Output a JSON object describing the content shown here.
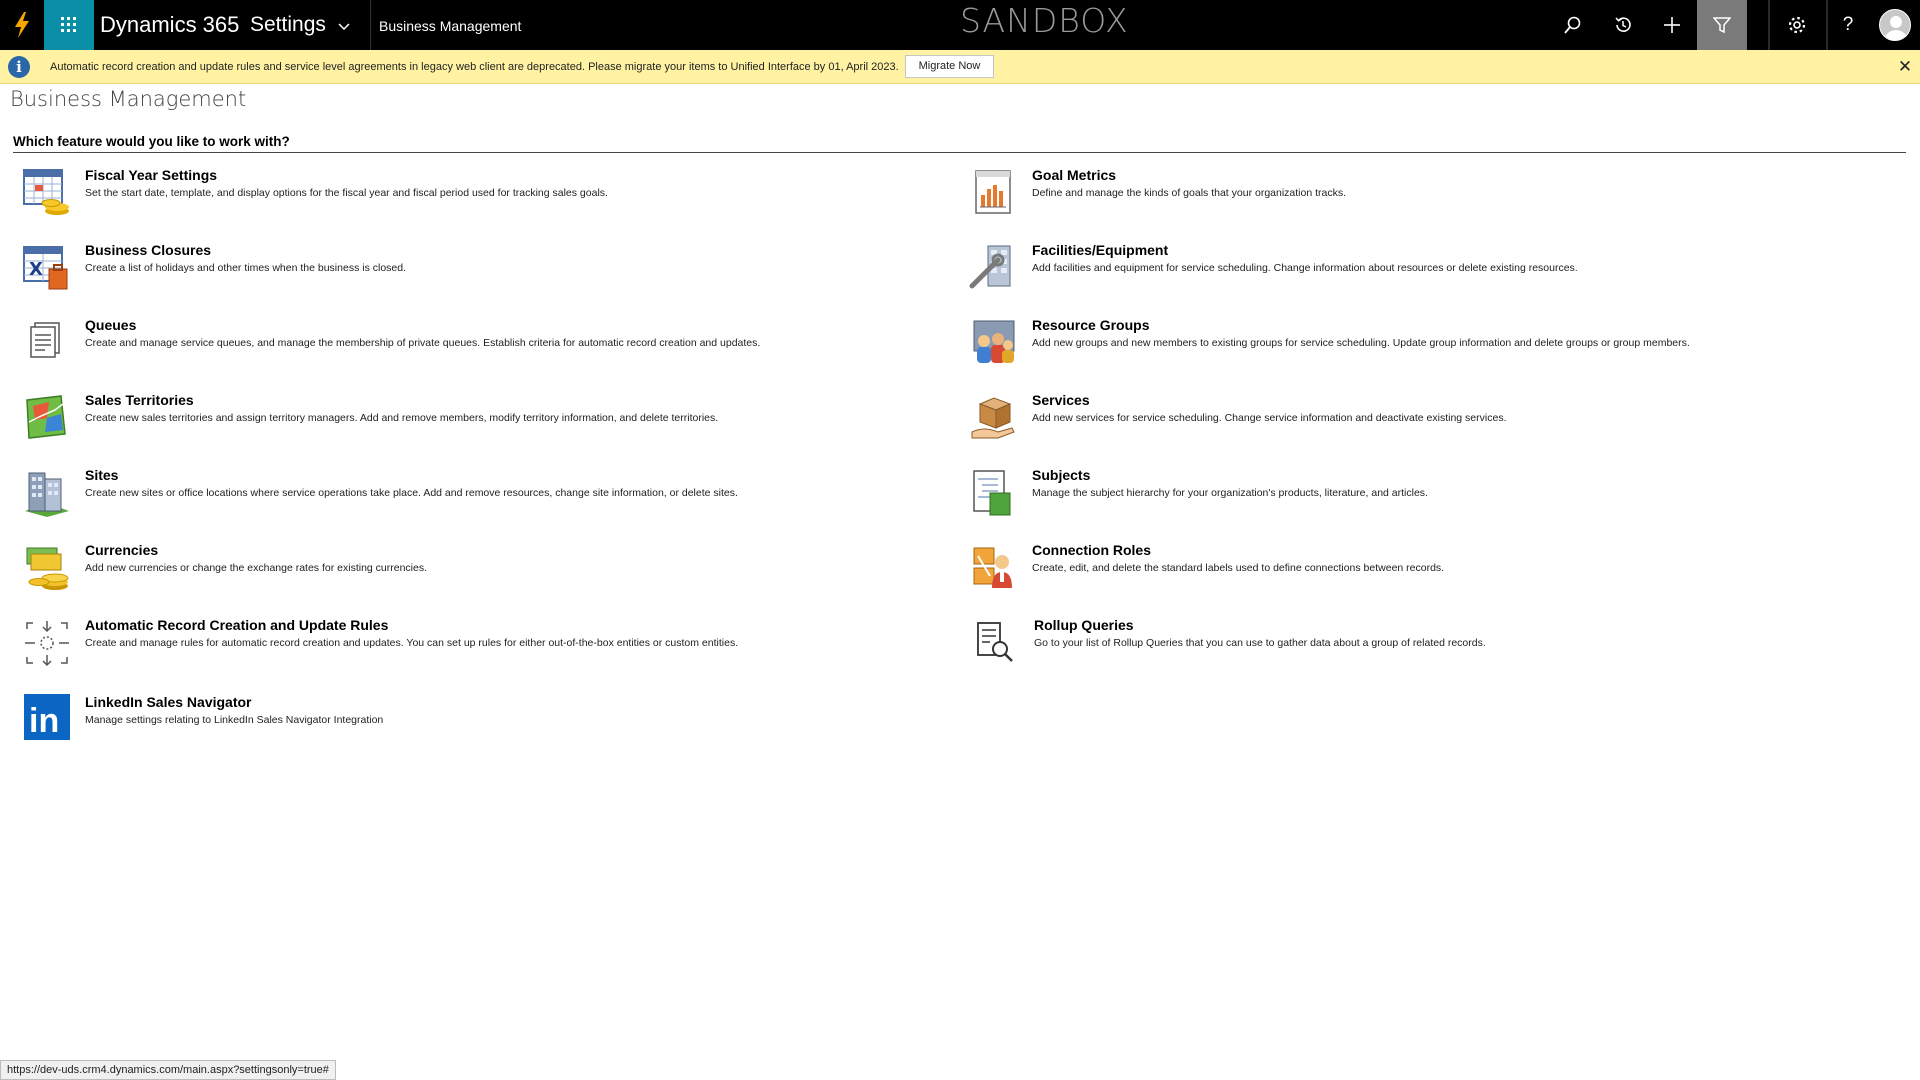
{
  "topbar": {
    "app_name": "Dynamics 365",
    "area": "Settings",
    "breadcrumb": "Business Management",
    "environment_label": "SANDBOX",
    "icons": [
      "bolt-icon",
      "waffle-icon",
      "search-icon",
      "history-icon",
      "plus-icon",
      "filter-icon",
      "gear-icon",
      "help-icon",
      "avatar-icon"
    ],
    "help_label": "?"
  },
  "notice": {
    "text": "Automatic record creation and update rules and service level agreements in legacy web client are deprecated. Please migrate your items to Unified Interface by 01, April 2023.",
    "button": "Migrate Now",
    "info_glyph": "i",
    "close_glyph": "✕"
  },
  "page": {
    "title": "Business Management",
    "question": "Which feature would you like to work with?"
  },
  "features_left": [
    {
      "title": "Fiscal Year Settings",
      "desc": "Set the start date, template, and display options for the fiscal year and fiscal period used for tracking sales goals.",
      "icon": "calendar-coins-icon"
    },
    {
      "title": "Business Closures",
      "desc": "Create a list of holidays and other times when the business is closed.",
      "icon": "calendar-closure-icon"
    },
    {
      "title": "Queues",
      "desc": "Create and manage service queues, and manage the membership of private queues. Establish criteria for automatic record creation and updates.",
      "icon": "queue-icon"
    },
    {
      "title": "Sales Territories",
      "desc": "Create new sales territories and assign territory managers. Add and remove members, modify territory information, and delete territories.",
      "icon": "map-icon"
    },
    {
      "title": "Sites",
      "desc": "Create new sites or office locations where service operations take place. Add and remove resources, change site information, or delete sites.",
      "icon": "building-icon"
    },
    {
      "title": "Currencies",
      "desc": "Add new currencies or change the exchange rates for existing currencies.",
      "icon": "currency-icon"
    },
    {
      "title": "Automatic Record Creation and Update Rules",
      "desc": "Create and manage rules for automatic record creation and updates. You can set up rules for either out-of-the-box entities or custom entities.",
      "icon": "automation-icon"
    },
    {
      "title": "LinkedIn Sales Navigator",
      "desc": "Manage settings relating to LinkedIn Sales Navigator Integration",
      "icon": "linkedin-icon",
      "glyph": "in"
    }
  ],
  "features_right": [
    {
      "title": "Goal Metrics",
      "desc": "Define and manage the kinds of goals that your organization tracks.",
      "icon": "goal-chart-icon"
    },
    {
      "title": "Facilities/Equipment",
      "desc": "Add facilities and equipment for service scheduling. Change information about resources or delete existing resources.",
      "icon": "facility-tools-icon"
    },
    {
      "title": "Resource Groups",
      "desc": "Add new groups and new members to existing groups for service scheduling. Update group information and delete groups or group members.",
      "icon": "resource-group-icon"
    },
    {
      "title": "Services",
      "desc": "Add new services for service scheduling. Change service information and deactivate existing services.",
      "icon": "service-box-icon"
    },
    {
      "title": "Subjects",
      "desc": "Manage the subject hierarchy for your organization's products, literature, and articles.",
      "icon": "subjects-icon"
    },
    {
      "title": "Connection Roles",
      "desc": "Create, edit, and delete the standard labels used to define connections between records.",
      "icon": "connection-roles-icon"
    },
    {
      "title": "Rollup Queries",
      "desc": "Go to your list of Rollup Queries that you can use to gather data about a group of related records.",
      "icon": "rollup-query-icon"
    }
  ],
  "status_bar": {
    "url": "https://dev-uds.crm4.dynamics.com/main.aspx?settingsonly=true#"
  },
  "colors": {
    "topbar": "#000000",
    "waffle": "#0b8fa6",
    "notice": "#fff3a3",
    "bolt": "#f7a600"
  }
}
